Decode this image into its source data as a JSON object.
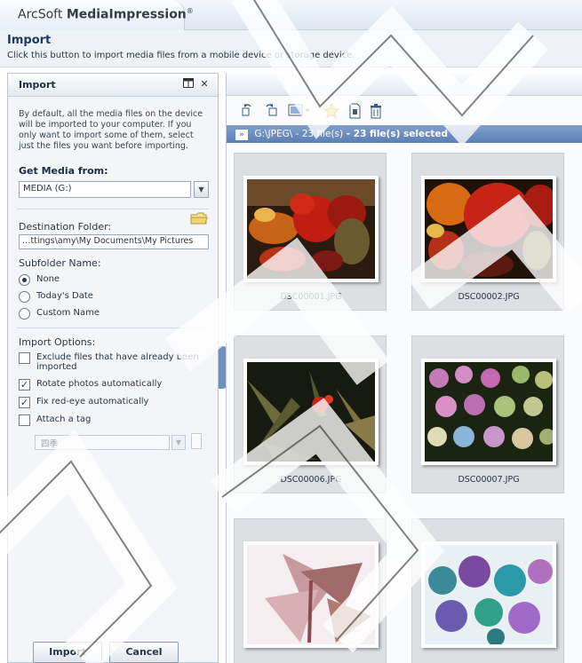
{
  "app": {
    "title_light": "ArcSoft",
    "title_bold": "MediaImpression",
    "title_mark": "®"
  },
  "header": {
    "title": "Import",
    "description": "Click this button to import media files from a mobile device or storage device."
  },
  "panel": {
    "title": "Import",
    "description": "By default, all the media files on the device will be imported to your computer. If you only want to import some of them, select just the files you want before importing.",
    "get_media_label": "Get Media from:",
    "source_value": "MEDIA (G:)",
    "destination_label": "Destination Folder:",
    "destination_value": "…ttings\\amy\\My Documents\\My Pictures",
    "subfolder_label": "Subfolder Name:",
    "subfolder_options": [
      {
        "label": "None",
        "selected": true
      },
      {
        "label": "Today's Date",
        "selected": false
      },
      {
        "label": "Custom Name",
        "selected": false
      }
    ],
    "import_options_label": "Import Options:",
    "options": [
      {
        "label": "Exclude files that have already been",
        "label2": "imported",
        "checked": false
      },
      {
        "label": "Rotate photos automatically",
        "checked": true
      },
      {
        "label": "Fix red-eye automatically",
        "checked": true
      },
      {
        "label": "Attach a tag",
        "checked": false
      }
    ],
    "tag_value": "四季",
    "import_button": "Import",
    "cancel_button": "Cancel"
  },
  "browser": {
    "path": "G:\\JPEG\\ - 23 file(s)",
    "selected": " - 23 file(s) selected",
    "thumbnails": [
      {
        "name": "DSC00001.JPG"
      },
      {
        "name": "DSC00002.JPG"
      },
      {
        "name": "DSC00006.JPG"
      },
      {
        "name": "DSC00007.JPG"
      },
      {
        "name": ""
      },
      {
        "name": ""
      }
    ]
  },
  "colors": {
    "pathbar": "#6f8fc4",
    "accent": "#1f3b63"
  }
}
